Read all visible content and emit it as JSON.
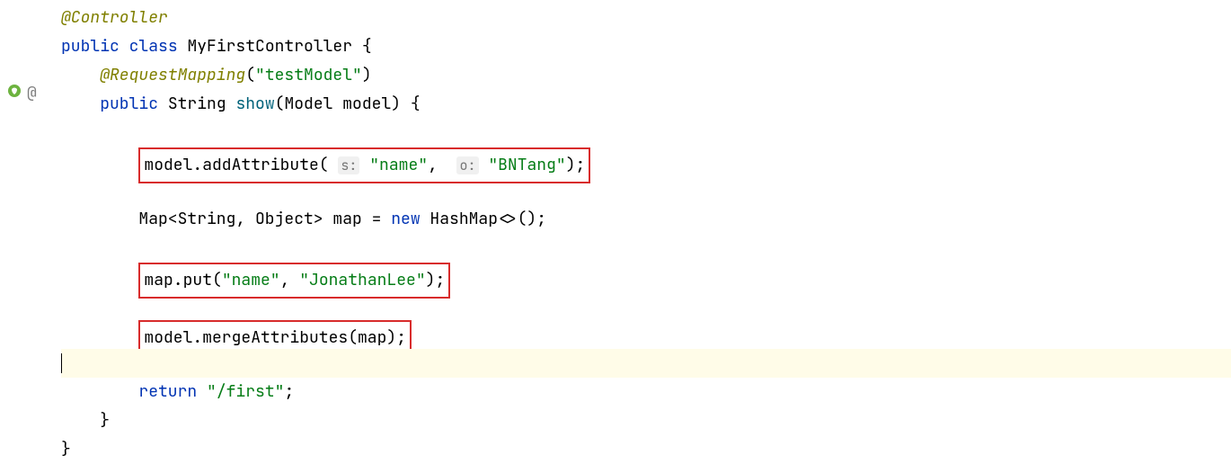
{
  "code": {
    "line1_annotation": "@Controller",
    "line2_public": "public",
    "line2_class": "class",
    "line2_name": "MyFirstController {",
    "line3_annotation": "@RequestMapping",
    "line3_paren_open": "(",
    "line3_string": "\"testModel\"",
    "line3_paren_close": ")",
    "line4_public": "public",
    "line4_type": "String",
    "line4_method": "show",
    "line4_params_open": "(Model model) {",
    "line6_call": "model.addAttribute(",
    "line6_hint1": "s:",
    "line6_str1": "\"name\"",
    "line6_comma": ", ",
    "line6_hint2": "o:",
    "line6_str2": "\"BNTang\"",
    "line6_end": ");",
    "line8_decl": "Map<String, Object> map = ",
    "line8_new": "new",
    "line8_ctor": " HashMap<>();",
    "line10_call": "map.put(",
    "line10_str1": "\"name\"",
    "line10_comma": ", ",
    "line10_str2": "\"JonathanLee\"",
    "line10_end": ");",
    "line12_call": "model.mergeAttributes(map);",
    "line14_return": "return",
    "line14_str": "\"/first\"",
    "line14_end": ";",
    "line15_brace": "}",
    "line16_brace": "}"
  },
  "gutter": {
    "at_symbol": "@"
  }
}
